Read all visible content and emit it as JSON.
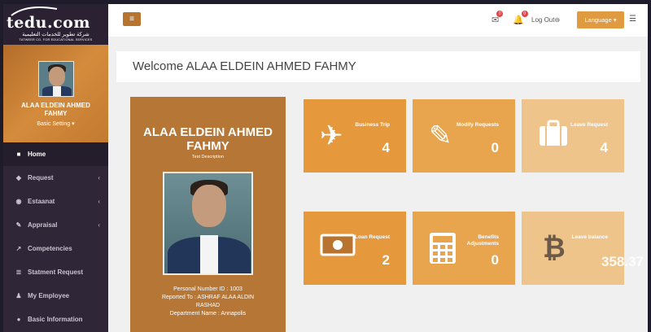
{
  "brand": {
    "logo_main": "tedu.com",
    "logo_ar": "شركة تطوير للخدمات التعليمية",
    "logo_en": "TATWEER CO. FOR EDUCATIONAL SERVICES"
  },
  "profile": {
    "name": "ALAA ELDEIN AHMED FAHMY",
    "setting_label": "Basic Setting ▾"
  },
  "nav": {
    "items": [
      {
        "label": "Home",
        "icon": "square-icon"
      },
      {
        "label": "Request",
        "icon": "diamond-icon"
      },
      {
        "label": "Estaanat",
        "icon": "eye-icon"
      },
      {
        "label": "Appraisal",
        "icon": "edit-icon"
      },
      {
        "label": "Competencies",
        "icon": "chart-icon"
      },
      {
        "label": "Statment Request",
        "icon": "list-icon"
      },
      {
        "label": "My Employee",
        "icon": "users-icon"
      },
      {
        "label": "Basic Information",
        "icon": "info-icon"
      }
    ]
  },
  "topbar": {
    "logout": "Log Out⊖",
    "language": "Language ▾",
    "mail_badge": "0",
    "bell_badge": "0"
  },
  "welcome": {
    "text": "Welcome ALAA ELDEIN AHMED FAHMY"
  },
  "card": {
    "name": "ALAA ELDEIN AHMED FAHMY",
    "description": "Test Description",
    "personal_number": "Personal Number ID : 1003",
    "reported_to": "Reported To : ASHRAF ALAA ALDIN RASHAD",
    "department": "Department Name : Annapolis"
  },
  "tiles": [
    {
      "label": "Business Trip",
      "value": "4",
      "icon": "plane-icon"
    },
    {
      "label": "Modify Requests",
      "value": "0",
      "icon": "edit-icon"
    },
    {
      "label": "Leave Request",
      "value": "4",
      "icon": "suitcase-icon"
    },
    {
      "label": "Loan Request",
      "value": "2",
      "icon": "money-icon"
    },
    {
      "label": "Benefits Adjustments",
      "value": "0",
      "icon": "calculator-icon"
    },
    {
      "label": "Leave balance",
      "value": "358.37",
      "icon": "bitcoin-icon"
    }
  ],
  "colors": {
    "sidebar": "#2f2637",
    "accent": "#e09a40",
    "card": "#b57636"
  }
}
